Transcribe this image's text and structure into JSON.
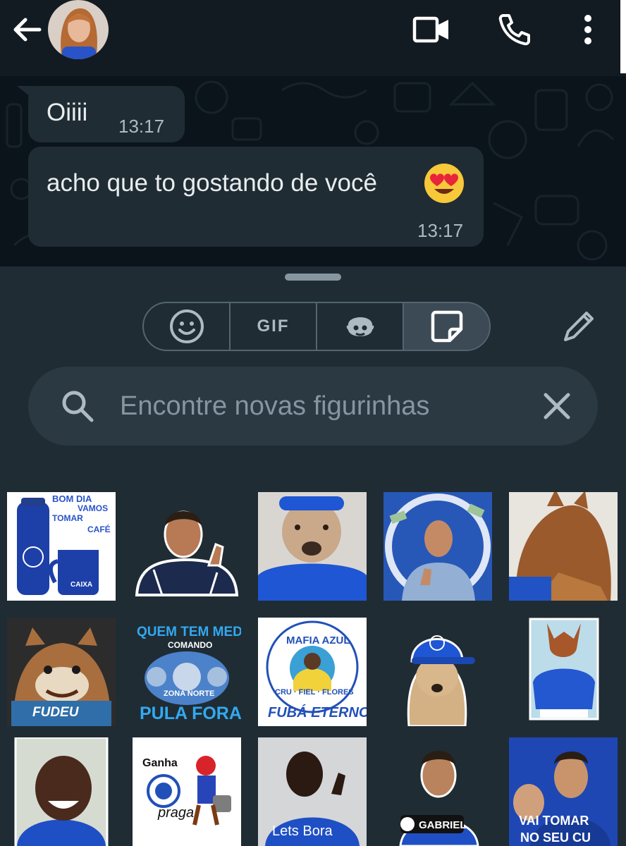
{
  "chat": {
    "messages": [
      {
        "text": "Oiiii",
        "time": "13:17"
      },
      {
        "text": "acho que to gostando de você",
        "time": "13:17"
      }
    ]
  },
  "tabs": [
    {
      "icon": "emoji-icon"
    },
    {
      "label": "GIF"
    },
    {
      "icon": "avatar-icon"
    },
    {
      "icon": "sticker-icon",
      "active": true
    }
  ],
  "search": {
    "placeholder": "Encontre novas figurinhas"
  },
  "stickers": {
    "s1_line1": "BOM DIA",
    "s1_line2": "VAMOS",
    "s1_line3": "TOMAR",
    "s1_line4": "CAFÉ",
    "s1_mug": "CAIXA",
    "s6": "FUDEU",
    "s7_line1": "QUEM TEM MEDO",
    "s7_line2": "COMANDO",
    "s7_line3": "ZONA NORTE",
    "s7_line4": "PULA FORA",
    "s8_line1": "MAFIA AZUL",
    "s8_line2": "CRU · FIEL · FLORES",
    "s8_line3": "FUBÁ ETERNO",
    "s12_line1": "Ganha",
    "s12_line2": "praga",
    "s13": "Lets Bora",
    "s14": "GABRIEL",
    "s15_line1": "VAI TOMAR",
    "s15_line2": "NO SEU CU"
  },
  "colors": {
    "background": "#121b22",
    "chat_background": "#0b141a",
    "bubble": "#202c33",
    "panel": "#1f2c34",
    "search_field": "#2a3942",
    "cruzeiro_blue": "#1c47b8"
  }
}
